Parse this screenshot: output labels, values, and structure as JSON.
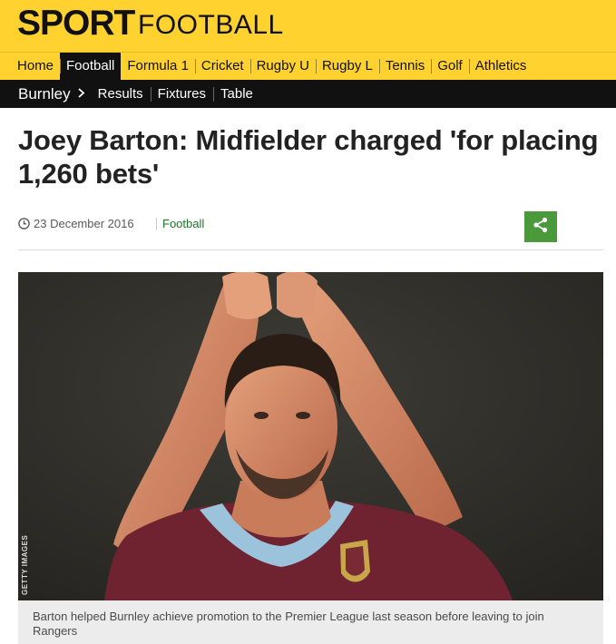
{
  "masthead": {
    "brand": "SPORT",
    "section": "FOOTBALL",
    "background_color": "#ffd230"
  },
  "primary_nav": {
    "items": [
      {
        "label": "Home",
        "active": false
      },
      {
        "label": "Football",
        "active": true
      },
      {
        "label": "Formula 1",
        "active": false
      },
      {
        "label": "Cricket",
        "active": false
      },
      {
        "label": "Rugby U",
        "active": false
      },
      {
        "label": "Rugby L",
        "active": false
      },
      {
        "label": "Tennis",
        "active": false
      },
      {
        "label": "Golf",
        "active": false
      },
      {
        "label": "Athletics",
        "active": false
      }
    ]
  },
  "secondary_nav": {
    "team": "Burnley",
    "chevron_icon": "chevron-right-icon",
    "links": [
      "Results",
      "Fixtures",
      "Table"
    ]
  },
  "article": {
    "headline": "Joey Barton: Midfielder charged 'for placing 1,260 bets'",
    "date": "23 December 2016",
    "topic": "Football",
    "topic_color": "#1d7328",
    "share_icon": "share-icon",
    "share_color": "#4a9a3c",
    "image": {
      "credit": "GETTY IMAGES",
      "caption": "Barton helped Burnley achieve promotion to the Premier League last season before leaving to join Rangers"
    }
  }
}
